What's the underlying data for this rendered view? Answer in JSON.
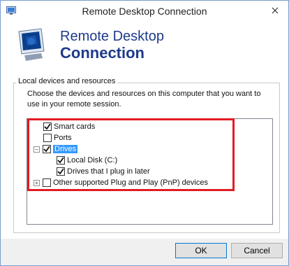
{
  "window": {
    "title": "Remote Desktop Connection",
    "icons": {
      "app": "remote-desktop-icon",
      "close": "close-icon"
    }
  },
  "banner": {
    "line1": "Remote Desktop",
    "line2": "Connection",
    "logo_icon": "remote-desktop-logo-icon"
  },
  "group": {
    "legend": "Local devices and resources",
    "description": "Choose the devices and resources on this computer that you want to use in your remote session."
  },
  "tree": {
    "items": [
      {
        "label": "Smart cards",
        "checked": true
      },
      {
        "label": "Ports",
        "checked": false
      },
      {
        "label": "Drives",
        "checked": true,
        "expander": "−",
        "selected": true
      },
      {
        "label": "Local Disk (C:)",
        "checked": true
      },
      {
        "label": "Drives that I plug in later",
        "checked": true
      },
      {
        "label": "Other supported Plug and Play (PnP) devices",
        "checked": false,
        "expander": "+"
      }
    ]
  },
  "buttons": {
    "ok": "OK",
    "cancel": "Cancel"
  },
  "colors": {
    "highlight": "#e21b23",
    "banner_text": "#1e3a8a",
    "selection": "#3399ff"
  }
}
